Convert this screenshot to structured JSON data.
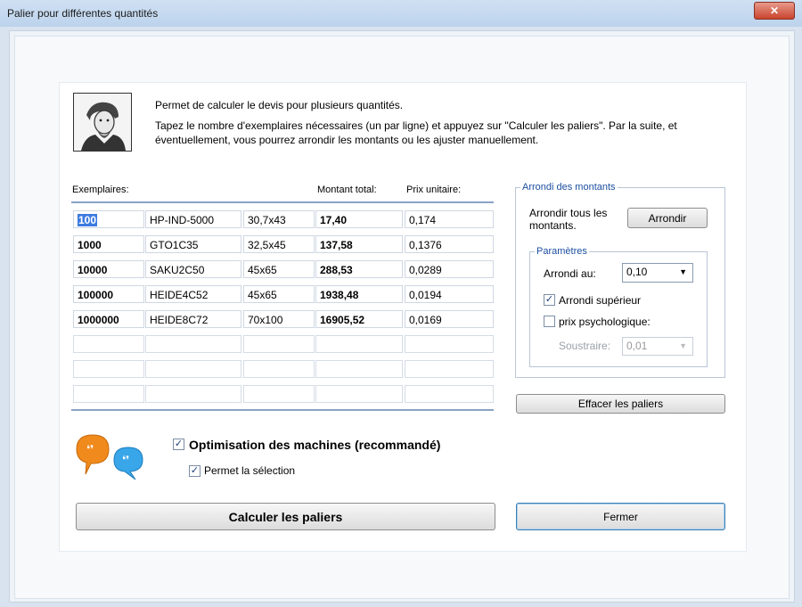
{
  "window": {
    "title": "Palier pour différentes quantités",
    "close_icon": "close-icon"
  },
  "header": {
    "line1": "Permet de calculer le devis pour plusieurs quantités.",
    "line2": "Tapez le nombre d'exemplaires nécessaires (un par ligne) et appuyez sur \"Calculer les paliers\". Par la suite, et éventuellement, vous pourrez arrondir les montants ou les ajuster manuellement."
  },
  "table": {
    "col_exemplaires": "Exemplaires:",
    "col_montant": "Montant total:",
    "col_prix": "Prix unitaire:",
    "rows": [
      {
        "qty": "100",
        "code": "HP-IND-5000",
        "format": "30,7x43",
        "montant": "17,40",
        "prix": "0,174"
      },
      {
        "qty": "1000",
        "code": "GTO1C35",
        "format": "32,5x45",
        "montant": "137,58",
        "prix": "0,1376"
      },
      {
        "qty": "10000",
        "code": "SAKU2C50",
        "format": "45x65",
        "montant": "288,53",
        "prix": "0,0289"
      },
      {
        "qty": "100000",
        "code": "HEIDE4C52",
        "format": "45x65",
        "montant": "1938,48",
        "prix": "0,0194"
      },
      {
        "qty": "1000000",
        "code": "HEIDE8C72",
        "format": "70x100",
        "montant": "16905,52",
        "prix": "0,0169"
      }
    ]
  },
  "arrondi": {
    "group_title": "Arrondi des montants",
    "description": "Arrondir tous les montants.",
    "button": "Arrondir",
    "params_title": "Paramètres",
    "arrondi_au_label": "Arrondi au:",
    "arrondi_au_value": "0,10",
    "arrondi_superieur": "Arrondi supérieur",
    "arrondi_superieur_checked": true,
    "prix_psy": "prix  psychologique:",
    "prix_psy_checked": false,
    "soustraire_label": "Soustraire:",
    "soustraire_value": "0,01"
  },
  "effacer_button": "Effacer les paliers",
  "options": {
    "optimisation": "Optimisation des machines (recommandé)",
    "optimisation_checked": true,
    "permet": "Permet la sélection",
    "permet_checked": true
  },
  "buttons": {
    "calculer": "Calculer les paliers",
    "fermer": "Fermer"
  }
}
